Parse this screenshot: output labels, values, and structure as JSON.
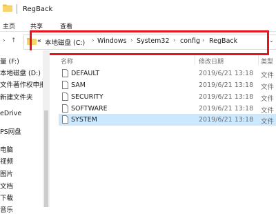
{
  "window": {
    "title": "RegBack"
  },
  "ribbon": {
    "tabs": [
      "主页",
      "共享",
      "查看"
    ]
  },
  "address": {
    "collapsed": "«",
    "crumbs": [
      "本地磁盘 (C:)",
      "Windows",
      "System32",
      "config",
      "RegBack"
    ],
    "separator": "›",
    "dropdown": "⌄"
  },
  "sidebar": {
    "items": [
      {
        "label": "量 (F:)"
      },
      {
        "label": "本地磁盘 (D:)"
      },
      {
        "label": "文件著作权申报"
      },
      {
        "label": "新建文件夹"
      },
      {
        "label": "eDrive"
      },
      {
        "label": "PS网盘"
      },
      {
        "label": "电脑"
      },
      {
        "label": "视频"
      },
      {
        "label": "图片"
      },
      {
        "label": "文档"
      },
      {
        "label": "下载"
      },
      {
        "label": "音乐"
      }
    ]
  },
  "list": {
    "headers": {
      "name": "名称",
      "date": "修改日期",
      "type": "类型"
    },
    "rows": [
      {
        "name": "DEFAULT",
        "date": "2019/6/21 13:18",
        "type": "文件"
      },
      {
        "name": "SAM",
        "date": "2019/6/21 13:18",
        "type": "文件"
      },
      {
        "name": "SECURITY",
        "date": "2019/6/21 13:18",
        "type": "文件"
      },
      {
        "name": "SOFTWARE",
        "date": "2019/6/21 13:18",
        "type": "文件"
      },
      {
        "name": "SYSTEM",
        "date": "2019/6/21 13:18",
        "type": "文件",
        "selected": true
      }
    ]
  },
  "colors": {
    "highlight_border": "#e8121f",
    "selection": "#cce8ff",
    "folder": "#f0c24b"
  }
}
